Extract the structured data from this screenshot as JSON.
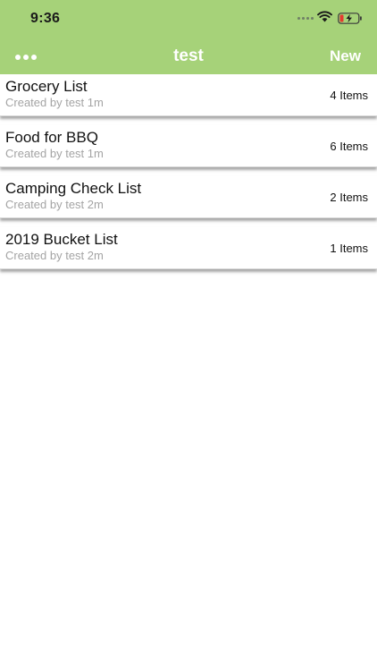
{
  "status_bar": {
    "time": "9:36",
    "icons": [
      "cellular-signal-icon",
      "wifi-icon",
      "battery-charging-icon"
    ]
  },
  "header": {
    "title": "test",
    "more_icon": "more-dots-icon",
    "new_label": "New",
    "background_color": "#a6d279"
  },
  "lists": [
    {
      "title": "Grocery List",
      "subtitle": "Created by test 1m",
      "count": "4 Items"
    },
    {
      "title": "Food for BBQ",
      "subtitle": "Created by test 1m",
      "count": "6 Items"
    },
    {
      "title": "Camping Check List",
      "subtitle": "Created by test 2m",
      "count": "2 Items"
    },
    {
      "title": "2019 Bucket List",
      "subtitle": "Created by test 2m",
      "count": "1 Items"
    }
  ]
}
